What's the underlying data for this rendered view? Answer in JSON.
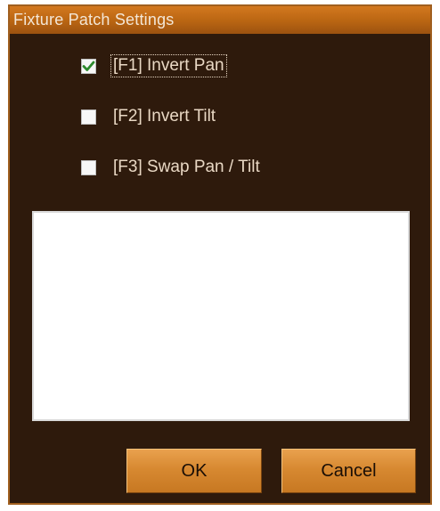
{
  "window": {
    "title": "Fixture Patch Settings"
  },
  "options": [
    {
      "label": "[F1] Invert Pan",
      "checked": true
    },
    {
      "label": "[F2] Invert Tilt",
      "checked": false
    },
    {
      "label": "[F3] Swap Pan / Tilt",
      "checked": false
    }
  ],
  "buttons": {
    "ok_label": "OK",
    "cancel_label": "Cancel"
  },
  "colors": {
    "window_bg": "#2e1a0c",
    "titlebar": "#b96512",
    "button": "#d78931",
    "check_mark": "#2e8b2e"
  }
}
